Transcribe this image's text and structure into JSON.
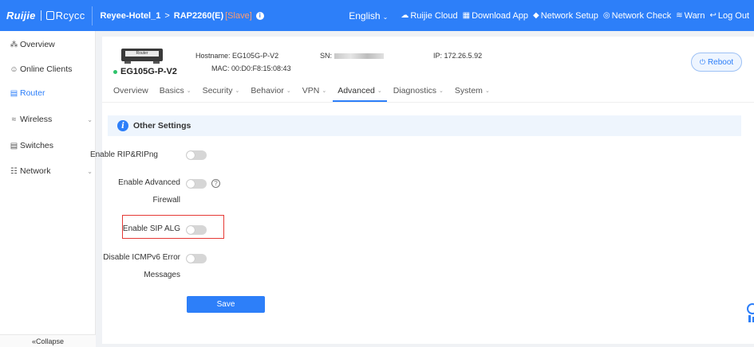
{
  "brand": {
    "logo_primary": "Ruijie",
    "logo_secondary": "Rcycc"
  },
  "breadcrumb": {
    "network": "Reyee-Hotel_1",
    "device": "RAP2260(E)",
    "role": "[Slave]"
  },
  "topnav": {
    "language": "English",
    "items": [
      {
        "label": "Ruijie Cloud",
        "icon": "cloud-icon"
      },
      {
        "label": "Download App",
        "icon": "qr-code-icon"
      },
      {
        "label": "Network Setup",
        "icon": "network-setup-icon"
      },
      {
        "label": "Network Check",
        "icon": "network-check-icon"
      },
      {
        "label": "Warn",
        "icon": "warn-icon"
      },
      {
        "label": "Log Out",
        "icon": "logout-icon"
      }
    ]
  },
  "sidebar": {
    "items": [
      {
        "label": "Overview",
        "icon": "overview-icon"
      },
      {
        "label": "Online Clients",
        "icon": "clients-icon"
      },
      {
        "label": "Router",
        "icon": "router-icon",
        "active": true
      },
      {
        "label": "Wireless",
        "icon": "wifi-icon",
        "expandable": true
      },
      {
        "label": "Switches",
        "icon": "switch-icon"
      },
      {
        "label": "Network",
        "icon": "network-icon",
        "expandable": true
      }
    ],
    "collapse_label": "Collapse"
  },
  "device": {
    "image_label": "Router",
    "name": "EG105G-P-V2",
    "status_color": "#2ec36b",
    "hostname_label": "Hostname:",
    "hostname": "EG105G-P-V2",
    "mac_label": "MAC:",
    "mac": "00:D0:F8:15:08:43",
    "sn_label": "SN:",
    "ip_label": "IP:",
    "ip": "172.26.5.92",
    "reboot_label": "Reboot"
  },
  "tabs": [
    {
      "label": "Overview",
      "dropdown": false
    },
    {
      "label": "Basics",
      "dropdown": true
    },
    {
      "label": "Security",
      "dropdown": true
    },
    {
      "label": "Behavior",
      "dropdown": true
    },
    {
      "label": "VPN",
      "dropdown": true
    },
    {
      "label": "Advanced",
      "dropdown": true,
      "active": true
    },
    {
      "label": "Diagnostics",
      "dropdown": true
    },
    {
      "label": "System",
      "dropdown": true
    }
  ],
  "section": {
    "title": "Other Settings",
    "fields": [
      {
        "label_line1": "Enable RIP&RIPng",
        "label_line2": "",
        "enabled": false
      },
      {
        "label_line1": "Enable Advanced",
        "label_line2": "Firewall",
        "enabled": false,
        "help": "?"
      },
      {
        "label_line1": "Enable SIP ALG",
        "label_line2": "",
        "enabled": false,
        "highlighted": true
      },
      {
        "label_line1": "Disable ICMPv6 Error",
        "label_line2": "Messages",
        "enabled": false
      }
    ],
    "save_label": "Save"
  },
  "colors": {
    "primary": "#2d7ff9",
    "highlight": "#e53935",
    "slave": "#ff9c6e"
  }
}
